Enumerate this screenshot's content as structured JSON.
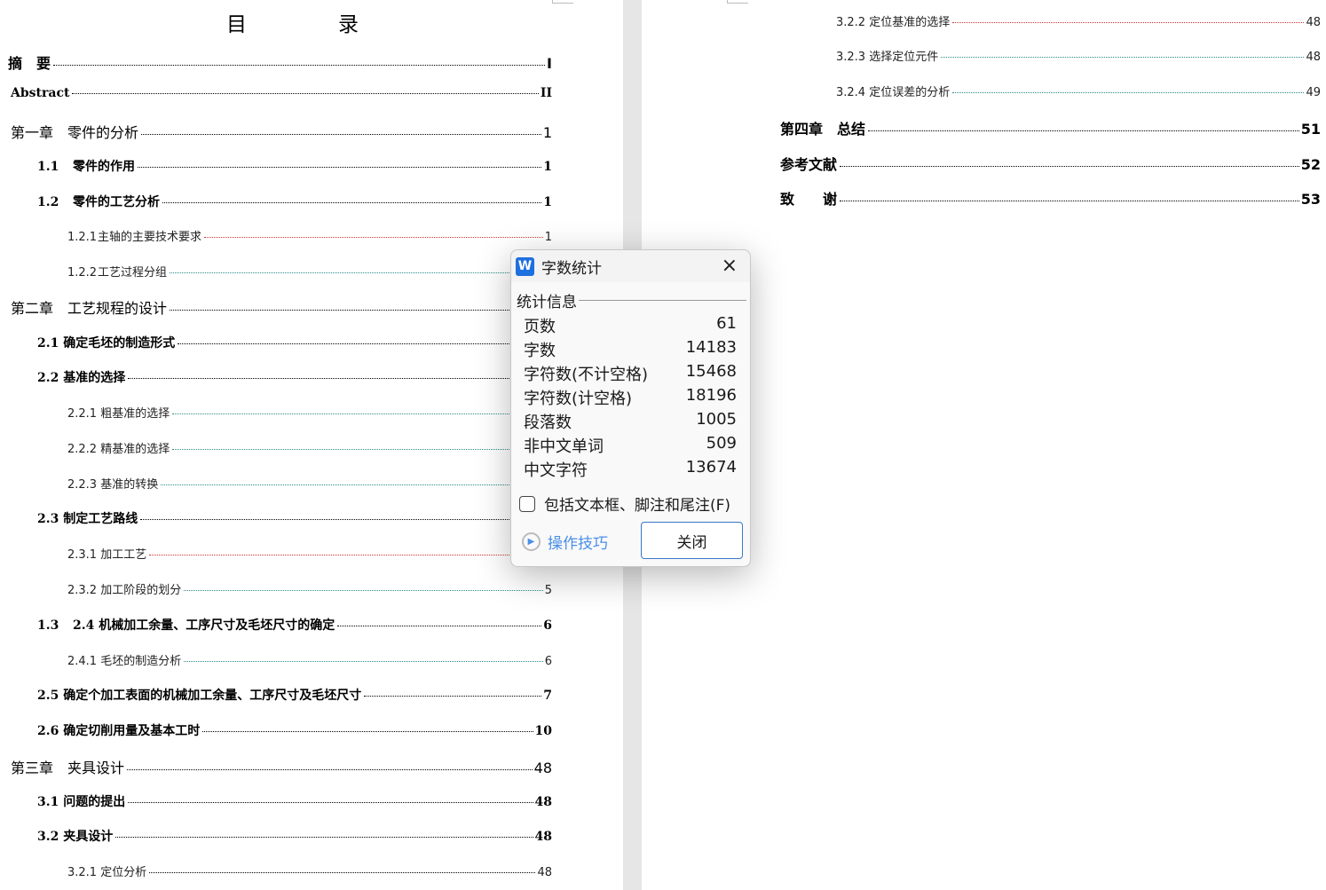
{
  "left_page": {
    "title": "目　录",
    "entries": [
      {
        "num": "",
        "label": "摘　要",
        "page": "I"
      },
      {
        "num": "",
        "label": "Abstract",
        "page": "II"
      },
      {
        "num": "",
        "label": "第一章　零件的分析",
        "page": "1"
      },
      {
        "num": "1.1",
        "label": "零件的作用",
        "page": "1"
      },
      {
        "num": "1.2",
        "label": "零件的工艺分析",
        "page": "1"
      },
      {
        "num": "1.2.1",
        "label": "主轴的主要技术要求",
        "page": "1"
      },
      {
        "num": "1.2.2",
        "label": "工艺过程分组",
        "page": ""
      },
      {
        "num": "",
        "label": "第二章　工艺规程的设计",
        "page": ""
      },
      {
        "num": "",
        "label": "2.1 确定毛坯的制造形式",
        "page": ""
      },
      {
        "num": "",
        "label": "2.2 基准的选择",
        "page": ""
      },
      {
        "num": "",
        "label": "2.2.1 粗基准的选择",
        "page": ""
      },
      {
        "num": "",
        "label": "2.2.2 精基准的选择",
        "page": ""
      },
      {
        "num": "",
        "label": "2.2.3 基准的转换",
        "page": ""
      },
      {
        "num": "",
        "label": "2.3 制定工艺路线",
        "page": ""
      },
      {
        "num": "",
        "label": "2.3.1 加工工艺",
        "page": ""
      },
      {
        "num": "",
        "label": "2.3.2 加工阶段的划分",
        "page": "5"
      },
      {
        "num": "1.3",
        "label": "2.4 机械加工余量、工序尺寸及毛坯尺寸的确定",
        "page": "6"
      },
      {
        "num": "",
        "label": "2.4.1 毛坯的制造分析",
        "page": "6"
      },
      {
        "num": "",
        "label": "2.5 确定个加工表面的机械加工余量、工序尺寸及毛坯尺寸",
        "page": "7"
      },
      {
        "num": "",
        "label": "2.6 确定切削用量及基本工时",
        "page": "10"
      },
      {
        "num": "",
        "label": "第三章　夹具设计",
        "page": "48"
      },
      {
        "num": "",
        "label": "3.1 问题的提出",
        "page": "48"
      },
      {
        "num": "",
        "label": "3.2 夹具设计",
        "page": "48"
      },
      {
        "num": "",
        "label": "3.2.1 定位分析",
        "page": "48"
      }
    ]
  },
  "right_page": {
    "entries": [
      {
        "label": "3.2.2 定位基准的选择",
        "page": "48"
      },
      {
        "label": "3.2.3 选择定位元件",
        "page": "48"
      },
      {
        "label": "3.2.4 定位误差的分析",
        "page": "49"
      },
      {
        "label": "第四章　总结",
        "page": "51"
      },
      {
        "label": "参考文献",
        "page": "52"
      },
      {
        "label": "致　　谢",
        "page": "53"
      }
    ]
  },
  "dialog": {
    "logo": "W",
    "title": "字数统计",
    "close_icon": "×",
    "group": "统计信息",
    "stats": [
      {
        "label": "页数",
        "value": "61"
      },
      {
        "label": "字数",
        "value": "14183"
      },
      {
        "label": "字符数(不计空格)",
        "value": "15468"
      },
      {
        "label": "字符数(计空格)",
        "value": "18196"
      },
      {
        "label": "段落数",
        "value": "1005"
      },
      {
        "label": "非中文单词",
        "value": "509"
      },
      {
        "label": "中文字符",
        "value": "13674"
      }
    ],
    "checkbox_label": "包括文本框、脚注和尾注(F)",
    "checkbox_checked": false,
    "tips_label": "操作技巧",
    "close_button": "关闭"
  }
}
